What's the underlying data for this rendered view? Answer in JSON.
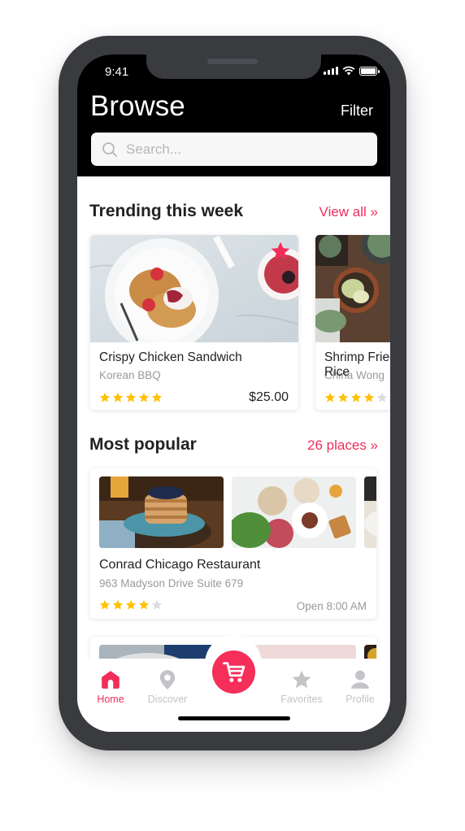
{
  "status_bar": {
    "time": "9:41",
    "battery_level": 1.0
  },
  "header": {
    "title": "Browse",
    "filter_label": "Filter",
    "search_placeholder": "Search...",
    "search_value": ""
  },
  "trending": {
    "title": "Trending this week",
    "link_label": "View all »",
    "items": [
      {
        "name": "Crispy Chicken Sandwich",
        "subtitle": "Korean BBQ",
        "rating": 5,
        "max_rating": 5,
        "price": "$25.00",
        "favorited": true,
        "image": "pancakes-strawberries"
      },
      {
        "name": "Shrimp Fried Rice",
        "subtitle": "China Wong",
        "rating": 4,
        "max_rating": 5,
        "price": "",
        "favorited": false,
        "image": "succulents"
      }
    ]
  },
  "popular": {
    "title": "Most popular",
    "link_label": "26 places »",
    "items": [
      {
        "name": "Conrad Chicago Restaurant",
        "address": "963 Madyson Drive Suite 679",
        "rating": 4,
        "max_rating": 5,
        "hours": "Open 8:00 AM",
        "images": [
          "blueberry-pancakes",
          "brunch-table",
          "plate"
        ]
      }
    ]
  },
  "tabbar": {
    "items": [
      {
        "label": "Home",
        "icon": "home-icon",
        "active": true
      },
      {
        "label": "Discover",
        "icon": "location-pin-icon",
        "active": false
      },
      {
        "label": "",
        "icon": "cart-icon",
        "active": false
      },
      {
        "label": "Favorites",
        "icon": "star-icon",
        "active": false
      },
      {
        "label": "Profile",
        "icon": "user-icon",
        "active": false
      }
    ]
  },
  "colors": {
    "accent": "#f02e5a",
    "star_filled": "#ffc107",
    "star_empty": "#dcdce0",
    "tab_inactive": "#c4c4c8",
    "header_bg": "#000000"
  }
}
